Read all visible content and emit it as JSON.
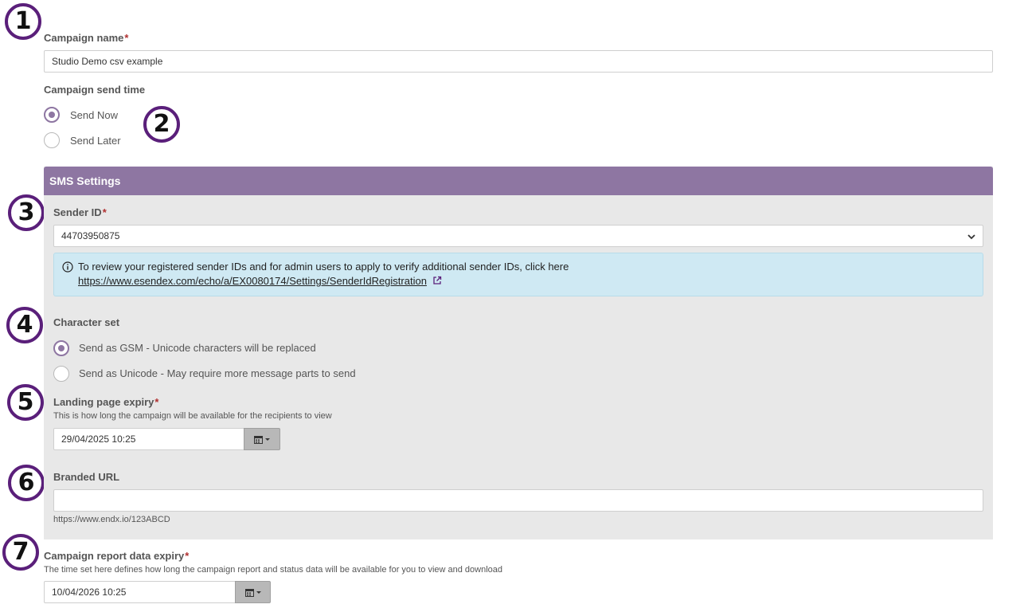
{
  "annotations": [
    "1",
    "2",
    "3",
    "4",
    "5",
    "6",
    "7"
  ],
  "campaign_name": {
    "label": "Campaign name",
    "required_mark": "*",
    "value": "Studio Demo csv example"
  },
  "send_time": {
    "label": "Campaign send time",
    "options": [
      {
        "label": "Send Now",
        "selected": true
      },
      {
        "label": "Send Later",
        "selected": false
      }
    ]
  },
  "sms_settings": {
    "title": "SMS Settings",
    "sender_id": {
      "label": "Sender ID",
      "required_mark": "*",
      "value": "44703950875"
    },
    "info": {
      "icon": "info-circle-icon",
      "text": "To review your registered sender IDs and for admin users to apply to verify additional sender IDs, click here",
      "link": "https://www.esendex.com/echo/a/EX0080174/Settings/SenderIdRegistration"
    },
    "character_set": {
      "label": "Character set",
      "options": [
        {
          "label": "Send as GSM - Unicode characters will be replaced",
          "selected": true
        },
        {
          "label": "Send as Unicode - May require more message parts to send",
          "selected": false
        }
      ]
    },
    "landing_expiry": {
      "label": "Landing page expiry",
      "required_mark": "*",
      "help": "This is how long the campaign will be available for the recipients to view",
      "value": "29/04/2025 10:25"
    },
    "branded_url": {
      "label": "Branded URL",
      "value": "",
      "help": "https://www.endx.io/123ABCD"
    }
  },
  "report_expiry": {
    "label": "Campaign report data expiry",
    "required_mark": "*",
    "help": "The time set here defines how long the campaign report and status data will be available for you to view and download",
    "value": "10/04/2026 10:25"
  },
  "colors": {
    "accent": "#8e76a2",
    "badge_border": "#5a1f7a",
    "panel_bg": "#e8e8e8",
    "info_bg": "#cfe9f3",
    "required": "#b03030"
  }
}
